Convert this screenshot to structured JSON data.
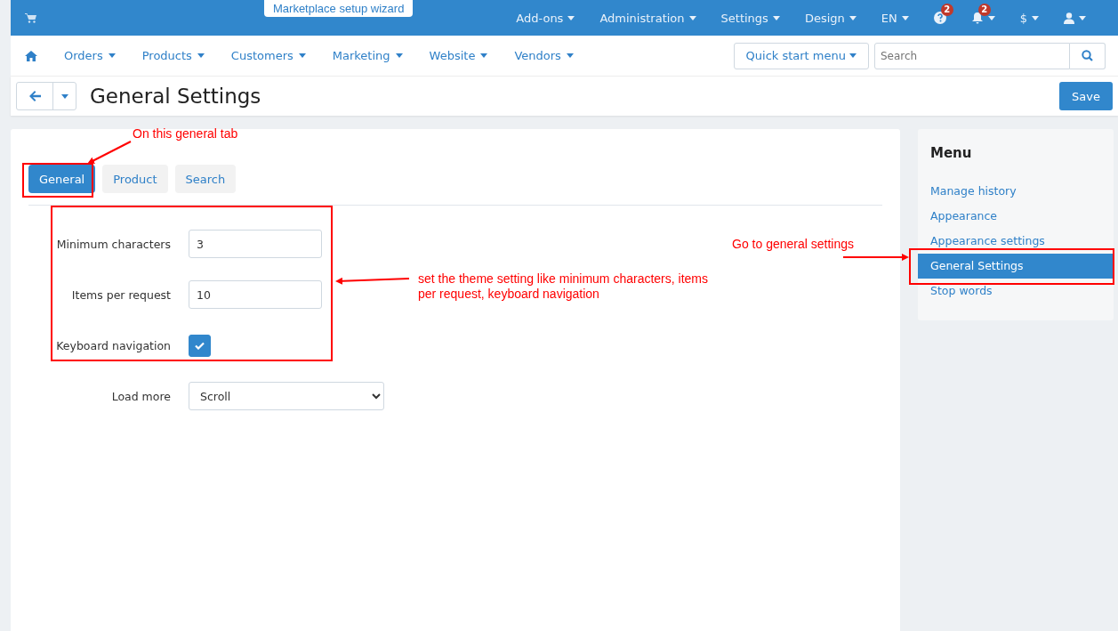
{
  "top_bar": {
    "wizard_tab": "Marketplace setup wizard",
    "menus": [
      {
        "kind": "text",
        "label": "Add-ons"
      },
      {
        "kind": "text",
        "label": "Administration"
      },
      {
        "kind": "text",
        "label": "Settings"
      },
      {
        "kind": "text",
        "label": "Design"
      },
      {
        "kind": "text",
        "label": "EN"
      },
      {
        "kind": "help",
        "badge": "2"
      },
      {
        "kind": "bell",
        "badge": "2"
      },
      {
        "kind": "text",
        "label": "$"
      },
      {
        "kind": "user"
      }
    ]
  },
  "nav": {
    "items": [
      "Orders",
      "Products",
      "Customers",
      "Marketing",
      "Website",
      "Vendors"
    ],
    "quick_start": "Quick start menu",
    "search": {
      "placeholder": "Search"
    }
  },
  "page": {
    "title": "General Settings",
    "save": "Save"
  },
  "tabs": [
    {
      "label": "General",
      "selected": true
    },
    {
      "label": "Product",
      "selected": false
    },
    {
      "label": "Search",
      "selected": false
    }
  ],
  "fields": [
    {
      "kind": "input",
      "label": "Minimum characters",
      "value": "3"
    },
    {
      "kind": "input",
      "label": "Items per request",
      "value": "10"
    },
    {
      "kind": "checkbox",
      "label": "Keyboard navigation",
      "checked": true
    },
    {
      "kind": "select",
      "label": "Load more",
      "value": "Scroll"
    }
  ],
  "sidebar": {
    "title": "Menu",
    "items": [
      {
        "label": "Manage history",
        "selected": false
      },
      {
        "label": "Appearance",
        "selected": false
      },
      {
        "label": "Appearance settings",
        "selected": false
      },
      {
        "label": "General Settings",
        "selected": true
      },
      {
        "label": "Stop words",
        "selected": false
      }
    ]
  },
  "annotations": [
    "On this general tab",
    "set the theme setting like minimum characters, items per request, keyboard navigation",
    "Go to general settings"
  ]
}
